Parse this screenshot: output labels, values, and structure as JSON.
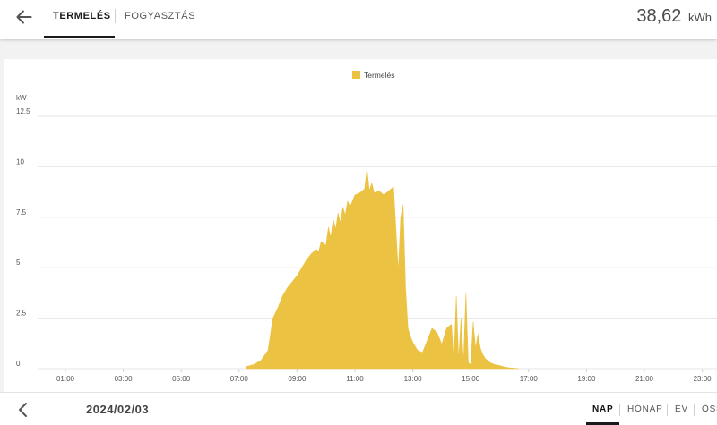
{
  "header": {
    "tabs": [
      {
        "label": "TERMELÉS",
        "active": true
      },
      {
        "label": "FOGYASZTÁS",
        "active": false
      }
    ],
    "total_value": "38,62",
    "total_unit": "kWh"
  },
  "footer": {
    "date": "2024/02/03",
    "periods": [
      {
        "label": "NAP",
        "active": true
      },
      {
        "label": "HÓNAP",
        "active": false
      },
      {
        "label": "ÉV",
        "active": false
      },
      {
        "label": "ÖSS",
        "active": false
      }
    ]
  },
  "icons": {
    "back": "arrow-left-icon",
    "prev": "chevron-left-icon"
  },
  "colors": {
    "series": "#ecc242",
    "grid": "#e6e6e6",
    "axis_text": "#555555"
  },
  "chart_data": {
    "type": "area",
    "ylabel": "kW",
    "ylim": [
      0,
      12.5
    ],
    "yticks": [
      "0",
      "2.5",
      "5",
      "7.5",
      "10",
      "12.5"
    ],
    "xticks": [
      "01:00",
      "03:00",
      "05:00",
      "07:00",
      "09:00",
      "11:00",
      "13:00",
      "15:00",
      "17:00",
      "19:00",
      "21:00",
      "23:00"
    ],
    "grid": true,
    "legend": "top-center",
    "series": [
      {
        "name": "Termelés",
        "x": [
          "07:15",
          "07:30",
          "07:45",
          "08:00",
          "08:10",
          "08:20",
          "08:30",
          "08:40",
          "08:50",
          "09:00",
          "09:10",
          "09:20",
          "09:30",
          "09:40",
          "09:45",
          "09:50",
          "10:00",
          "10:05",
          "10:10",
          "10:15",
          "10:20",
          "10:25",
          "10:30",
          "10:35",
          "10:40",
          "10:45",
          "10:50",
          "11:00",
          "11:10",
          "11:15",
          "11:20",
          "11:25",
          "11:30",
          "11:35",
          "11:40",
          "11:50",
          "12:00",
          "12:10",
          "12:20",
          "12:30",
          "12:35",
          "12:40",
          "12:45",
          "12:50",
          "12:55",
          "13:00",
          "13:10",
          "13:20",
          "13:30",
          "13:40",
          "13:50",
          "14:00",
          "14:10",
          "14:20",
          "14:25",
          "14:30",
          "14:35",
          "14:40",
          "14:45",
          "14:50",
          "14:55",
          "15:00",
          "15:05",
          "15:10",
          "15:15",
          "15:20",
          "15:25",
          "15:30",
          "15:40",
          "15:50",
          "16:00",
          "16:10",
          "16:20",
          "16:30",
          "16:40"
        ],
        "values": [
          0.1,
          0.2,
          0.4,
          0.9,
          2.5,
          3.0,
          3.6,
          4.0,
          4.3,
          4.6,
          5.0,
          5.4,
          5.7,
          5.9,
          5.8,
          6.3,
          6.1,
          7.0,
          6.5,
          7.4,
          6.9,
          7.7,
          7.2,
          8.0,
          7.6,
          8.3,
          8.0,
          8.6,
          8.7,
          8.8,
          8.9,
          9.9,
          8.8,
          9.2,
          8.7,
          8.8,
          8.6,
          8.8,
          9.0,
          4.8,
          7.5,
          8.1,
          4.0,
          2.0,
          1.6,
          1.3,
          0.9,
          0.8,
          1.4,
          2.0,
          1.8,
          1.2,
          2.0,
          2.2,
          0.3,
          3.6,
          0.4,
          2.5,
          0.3,
          3.7,
          0.3,
          0.2,
          2.3,
          1.0,
          1.7,
          1.0,
          0.7,
          0.5,
          0.3,
          0.2,
          0.15,
          0.08,
          0.04,
          0.02,
          0.0
        ]
      }
    ]
  }
}
